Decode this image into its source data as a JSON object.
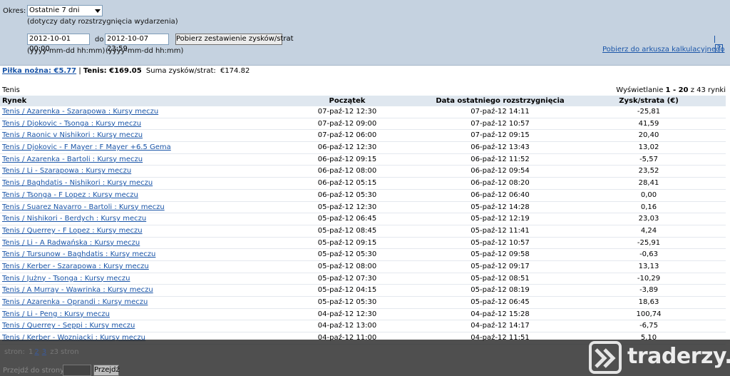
{
  "filters": {
    "period_label": "Okres:",
    "period_value": "Ostatnie 7 dni",
    "period_hint": "(dotyczy daty rozstrzygnięcia wydarzenia)",
    "from_value": "2012-10-01 00:00",
    "to_label": "do",
    "to_value": "2012-10-07 23:59",
    "from_format": "(yyyy-mm-dd hh:mm)",
    "to_format": "(yyyy-mm-dd hh:mm)",
    "fetch_button": "Pobierz zestawienie zysków/strat",
    "spreadsheet_link": "Pobierz do arkusza kalkulacyjnego",
    "help": "?"
  },
  "summary": {
    "football_link": "Piłka nożna: €5.77",
    "separator": "|",
    "tennis_text": "Tenis: €169.05",
    "total_label": "Suma zysków/strat:",
    "total_value": "€174.82"
  },
  "section_title": "Tenis",
  "showing": {
    "prefix": "Wyświetlanie",
    "range": "1 - 20",
    "suffix": "z 43 rynki"
  },
  "table": {
    "headers": {
      "market": "Rynek",
      "start": "Początek",
      "settled": "Data ostatniego rozstrzygnięcia",
      "pl": "Zysk/strata (€)"
    },
    "rows": [
      {
        "market": "Tenis / Azarenka - Szarapowa : Kursy meczu",
        "start": "07-paź-12 12:30",
        "settled": "07-paź-12 14:11",
        "pl": "-25,81"
      },
      {
        "market": "Tenis / Djokovic - Tsonga : Kursy meczu",
        "start": "07-paź-12 09:00",
        "settled": "07-paź-12 10:57",
        "pl": "41,59"
      },
      {
        "market": "Tenis / Raonic v Nishikori : Kursy meczu",
        "start": "07-paź-12 06:00",
        "settled": "07-paź-12 09:15",
        "pl": "20,40"
      },
      {
        "market": "Tenis / Djokovic - F Mayer : F Mayer +6.5 Gema",
        "start": "06-paź-12 12:30",
        "settled": "06-paź-12 13:43",
        "pl": "13,02"
      },
      {
        "market": "Tenis / Azarenka - Bartoli : Kursy meczu",
        "start": "06-paź-12 09:15",
        "settled": "06-paź-12 11:52",
        "pl": "-5,57"
      },
      {
        "market": "Tenis / Li - Szarapowa : Kursy meczu",
        "start": "06-paź-12 08:00",
        "settled": "06-paź-12 09:54",
        "pl": "23,52"
      },
      {
        "market": "Tenis / Baghdatis - Nishikori : Kursy meczu",
        "start": "06-paź-12 05:15",
        "settled": "06-paź-12 08:20",
        "pl": "28,41"
      },
      {
        "market": "Tenis / Tsonga - F Lopez : Kursy meczu",
        "start": "06-paź-12 05:30",
        "settled": "06-paź-12 06:40",
        "pl": "0,00"
      },
      {
        "market": "Tenis / Suarez Navarro - Bartoli : Kursy meczu",
        "start": "05-paź-12 12:30",
        "settled": "05-paź-12 14:28",
        "pl": "0,16"
      },
      {
        "market": "Tenis / Nishikori - Berdych : Kursy meczu",
        "start": "05-paź-12 06:45",
        "settled": "05-paź-12 12:19",
        "pl": "23,03"
      },
      {
        "market": "Tenis / Querrey - F Lopez : Kursy meczu",
        "start": "05-paź-12 08:45",
        "settled": "05-paź-12 11:41",
        "pl": "4,24"
      },
      {
        "market": "Tenis / Li - A Radwańska : Kursy meczu",
        "start": "05-paź-12 09:15",
        "settled": "05-paź-12 10:57",
        "pl": "-25,91"
      },
      {
        "market": "Tenis / Tursunow - Baghdatis : Kursy meczu",
        "start": "05-paź-12 05:30",
        "settled": "05-paź-12 09:58",
        "pl": "-0,63"
      },
      {
        "market": "Tenis / Kerber - Szarapowa : Kursy meczu",
        "start": "05-paź-12 08:00",
        "settled": "05-paź-12 09:17",
        "pl": "13,13"
      },
      {
        "market": "Tenis / Jużny - Tsonga : Kursy meczu",
        "start": "05-paź-12 07:30",
        "settled": "05-paź-12 08:51",
        "pl": "-10,29"
      },
      {
        "market": "Tenis / A Murray - Wawrinka : Kursy meczu",
        "start": "05-paź-12 04:15",
        "settled": "05-paź-12 08:19",
        "pl": "-3,89"
      },
      {
        "market": "Tenis / Azarenka - Oprandi : Kursy meczu",
        "start": "05-paź-12 05:30",
        "settled": "05-paź-12 06:45",
        "pl": "18,63"
      },
      {
        "market": "Tenis / Li - Peng : Kursy meczu",
        "start": "04-paź-12 12:30",
        "settled": "04-paź-12 15:28",
        "pl": "100,74"
      },
      {
        "market": "Tenis / Querrey - Seppi : Kursy meczu",
        "start": "04-paź-12 13:00",
        "settled": "04-paź-12 14:17",
        "pl": "-6,75"
      },
      {
        "market": "Tenis / Kerber - Wozniacki : Kursy meczu",
        "start": "04-paź-12 11:00",
        "settled": "04-paź-12 11:51",
        "pl": "5,10"
      }
    ]
  },
  "pager": {
    "pages_label": "stron:",
    "pages": [
      "1",
      "2",
      "3"
    ],
    "of_text": "z3 stron",
    "goto_label": "Przejdź do strony:",
    "goto_button": "Przejdź"
  },
  "watermark": {
    "text": "traderzy.pl"
  }
}
